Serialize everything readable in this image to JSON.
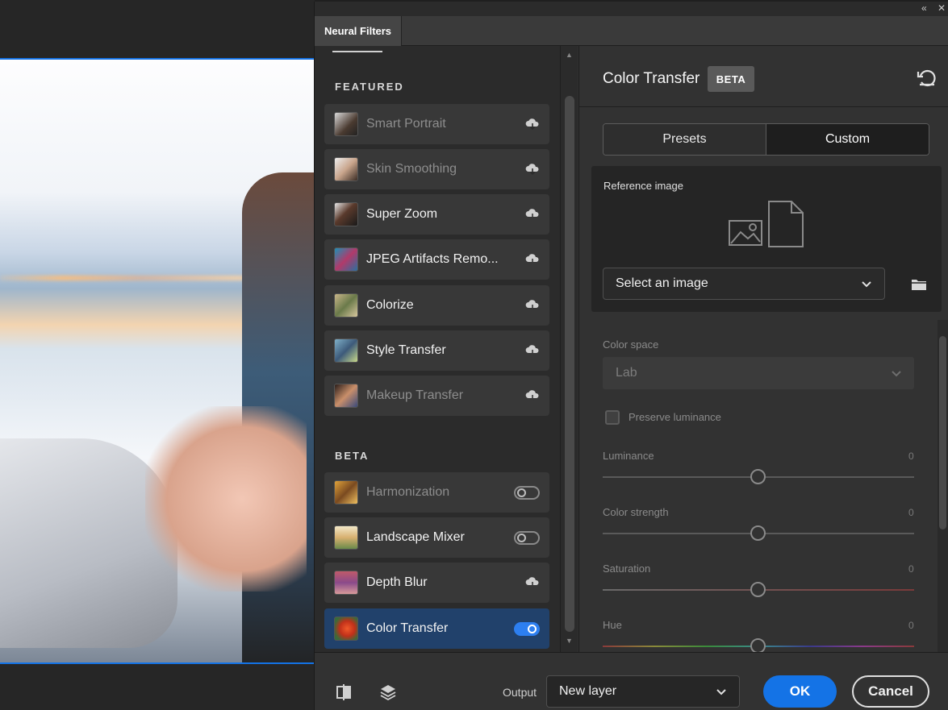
{
  "window": {
    "tab_title": "Neural Filters",
    "collapse_glyph": "«",
    "close_glyph": "✕"
  },
  "filter_list": {
    "featured_heading": "FEATURED",
    "beta_heading": "BETA",
    "featured": [
      {
        "label": "Smart Portrait",
        "state": "cloud",
        "dim": true
      },
      {
        "label": "Skin Smoothing",
        "state": "cloud",
        "dim": true
      },
      {
        "label": "Super Zoom",
        "state": "cloud",
        "dim": false
      },
      {
        "label": "JPEG Artifacts Remo...",
        "state": "cloud",
        "dim": false
      },
      {
        "label": "Colorize",
        "state": "cloud",
        "dim": false
      },
      {
        "label": "Style Transfer",
        "state": "cloud",
        "dim": false
      },
      {
        "label": "Makeup Transfer",
        "state": "cloud",
        "dim": true
      }
    ],
    "beta": [
      {
        "label": "Harmonization",
        "state": "toggle-off",
        "dim": true
      },
      {
        "label": "Landscape Mixer",
        "state": "toggle-off",
        "dim": false
      },
      {
        "label": "Depth Blur",
        "state": "cloud",
        "dim": false
      },
      {
        "label": "Color Transfer",
        "state": "toggle-on",
        "dim": false,
        "selected": true
      }
    ]
  },
  "settings": {
    "title": "Color Transfer",
    "badge": "BETA",
    "mode_tabs": [
      "Presets",
      "Custom"
    ],
    "active_mode": "Custom",
    "reference_label": "Reference image",
    "reference_select": "Select an image",
    "color_space_label": "Color space",
    "color_space_value": "Lab",
    "preserve_luminance_label": "Preserve luminance",
    "preserve_luminance_checked": false,
    "sliders": [
      {
        "label": "Luminance",
        "value": "0"
      },
      {
        "label": "Color strength",
        "value": "0"
      },
      {
        "label": "Saturation",
        "value": "0"
      },
      {
        "label": "Hue",
        "value": "0"
      }
    ]
  },
  "footer": {
    "output_label": "Output",
    "output_value": "New layer",
    "ok_label": "OK",
    "cancel_label": "Cancel"
  },
  "colors": {
    "accent": "#1473e6",
    "selected_item": "#21416b",
    "toggle_on": "#2d7ff0"
  }
}
